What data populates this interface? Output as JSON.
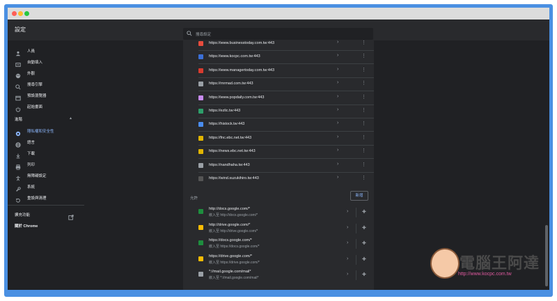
{
  "app": {
    "title": "設定"
  },
  "search": {
    "placeholder": "搜尋設定"
  },
  "sidebar": {
    "items": [
      {
        "label": "人員",
        "icon": "person-icon"
      },
      {
        "label": "自動填入",
        "icon": "autofill-icon"
      },
      {
        "label": "外觀",
        "icon": "palette-icon"
      },
      {
        "label": "搜尋引擎",
        "icon": "search-icon"
      },
      {
        "label": "預設瀏覽器",
        "icon": "browser-icon"
      },
      {
        "label": "起始畫面",
        "icon": "power-icon"
      }
    ],
    "advanced_label": "進階",
    "advanced_items": [
      {
        "label": "隱私權和安全性",
        "icon": "shield-icon",
        "active": true
      },
      {
        "label": "語言",
        "icon": "globe-icon"
      },
      {
        "label": "下載",
        "icon": "download-icon"
      },
      {
        "label": "列印",
        "icon": "print-icon"
      },
      {
        "label": "無障礙設定",
        "icon": "accessibility-icon"
      },
      {
        "label": "系統",
        "icon": "wrench-icon"
      },
      {
        "label": "重設與清理",
        "icon": "reset-icon"
      }
    ],
    "extensions_label": "擴充功能",
    "about_label": "關於 Chrome"
  },
  "blocked_sites": [
    {
      "url": "https://www.businesstoday.com.tw:443",
      "color": "#e84c3d"
    },
    {
      "url": "https://www.kocpc.com.tw:443",
      "color": "#3b6fd6"
    },
    {
      "url": "https://www.managertoday.com.tw:443",
      "color": "#d83b2f"
    },
    {
      "url": "https://rnrmad.com.tw:443",
      "color": "#9aa0a6"
    },
    {
      "url": "https://www.popdaily.com.tw:443",
      "color": "#c78bf0"
    },
    {
      "url": "https://ezlic.tw:443",
      "color": "#2e9e6a"
    },
    {
      "url": "https://histock.tw:443",
      "color": "#4a8df0"
    },
    {
      "url": "https://fnc.ebc.net.tw:443",
      "color": "#e0b400"
    },
    {
      "url": "https://news.ebc.net.tw:443",
      "color": "#e0b400"
    },
    {
      "url": "https://nandhaha.tw:443",
      "color": "#9aa0a6"
    },
    {
      "url": "https://wind.suzukihiro.tw:443",
      "color": "#555555"
    }
  ],
  "allow": {
    "title": "允許",
    "add_label": "新增",
    "items": [
      {
        "url": "http://docs.google.com/*",
        "sub": "嵌入至 http://docs.google.com/*",
        "color": "#1e8e3e"
      },
      {
        "url": "http://drive.google.com/*",
        "sub": "嵌入至 http://drive.google.com/*",
        "color": "#fbbc04"
      },
      {
        "url": "https://docs.google.com/*",
        "sub": "嵌入至 https://docs.google.com/*",
        "color": "#1e8e3e"
      },
      {
        "url": "https://drive.google.com/*",
        "sub": "嵌入至 https://drive.google.com/*",
        "color": "#fbbc04"
      },
      {
        "url": "*://mail.google.com/mail*",
        "sub": "嵌入至 *://mail.google.com/mail*",
        "color": "#9aa0a6"
      }
    ]
  },
  "watermark": {
    "title": "電腦王阿達",
    "url": "http://www.kocpc.com.tw"
  }
}
